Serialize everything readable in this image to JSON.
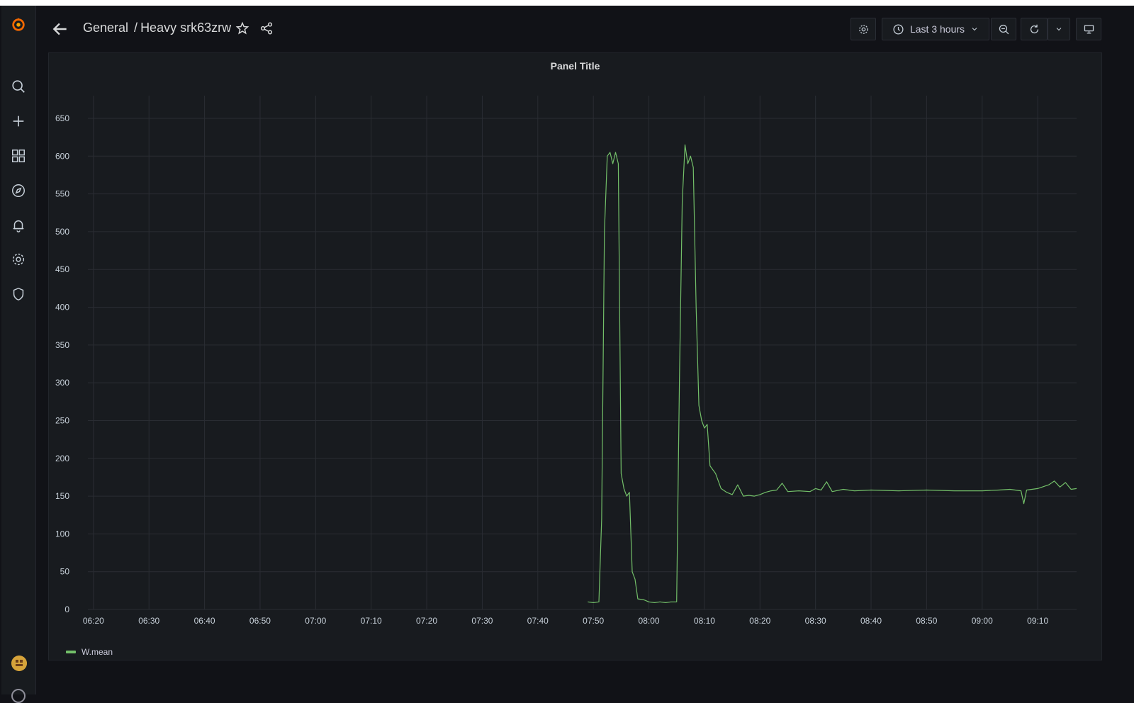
{
  "app": {
    "logo": "grafana-logo"
  },
  "sidebar": {
    "items": [
      {
        "icon": "search-icon"
      },
      {
        "icon": "plus-icon"
      },
      {
        "icon": "dashboards-icon"
      },
      {
        "icon": "explore-compass-icon"
      },
      {
        "icon": "alerting-bell-icon"
      },
      {
        "icon": "configuration-gear-icon"
      },
      {
        "icon": "server-admin-shield-icon"
      }
    ]
  },
  "header": {
    "breadcrumb": {
      "folder": "General",
      "separator": "/",
      "dashboard": "Heavy srk63zrw"
    },
    "time_picker": {
      "label": "Last 3 hours"
    }
  },
  "panel": {
    "title": "Panel Title",
    "legend": [
      {
        "name": "W.mean",
        "color": "#73bf69"
      }
    ]
  },
  "chart_data": {
    "type": "line",
    "title": "Panel Title",
    "xlabel": "",
    "ylabel": "",
    "x_ticks": [
      "06:20",
      "06:30",
      "06:40",
      "06:50",
      "07:00",
      "07:10",
      "07:20",
      "07:30",
      "07:40",
      "07:50",
      "08:00",
      "08:10",
      "08:20",
      "08:30",
      "08:40",
      "08:50",
      "09:00",
      "09:10"
    ],
    "y_ticks": [
      0,
      50,
      100,
      150,
      200,
      250,
      300,
      350,
      400,
      450,
      500,
      550,
      600,
      650
    ],
    "xlim": [
      "06:19",
      "09:17"
    ],
    "ylim": [
      0,
      680
    ],
    "grid": true,
    "legend_position": "bottom-left",
    "series": [
      {
        "name": "W.mean",
        "color": "#73bf69",
        "points": [
          [
            "07:49",
            10
          ],
          [
            "07:50",
            9
          ],
          [
            "07:51",
            10
          ],
          [
            "07:51.5",
            120
          ],
          [
            "07:52",
            500
          ],
          [
            "07:52.5",
            600
          ],
          [
            "07:53",
            605
          ],
          [
            "07:53.5",
            590
          ],
          [
            "07:54",
            605
          ],
          [
            "07:54.5",
            590
          ],
          [
            "07:55",
            180
          ],
          [
            "07:55.5",
            160
          ],
          [
            "07:56",
            150
          ],
          [
            "07:56.5",
            155
          ],
          [
            "07:57",
            50
          ],
          [
            "07:57.5",
            40
          ],
          [
            "07:58",
            14
          ],
          [
            "07:59",
            13
          ],
          [
            "08:00",
            10
          ],
          [
            "08:01",
            9
          ],
          [
            "08:02",
            10
          ],
          [
            "08:03",
            9
          ],
          [
            "08:04",
            10
          ],
          [
            "08:05",
            10
          ],
          [
            "08:05.5",
            300
          ],
          [
            "08:06",
            540
          ],
          [
            "08:06.5",
            615
          ],
          [
            "08:07",
            590
          ],
          [
            "08:07.5",
            600
          ],
          [
            "08:08",
            585
          ],
          [
            "08:08.5",
            400
          ],
          [
            "08:09",
            270
          ],
          [
            "08:09.5",
            250
          ],
          [
            "08:10",
            240
          ],
          [
            "08:10.5",
            245
          ],
          [
            "08:11",
            190
          ],
          [
            "08:12",
            180
          ],
          [
            "08:13",
            160
          ],
          [
            "08:14",
            155
          ],
          [
            "08:15",
            152
          ],
          [
            "08:16",
            165
          ],
          [
            "08:17",
            150
          ],
          [
            "08:18",
            151
          ],
          [
            "08:19",
            150
          ],
          [
            "08:20",
            152
          ],
          [
            "08:21",
            155
          ],
          [
            "08:22",
            157
          ],
          [
            "08:23",
            158
          ],
          [
            "08:24",
            167
          ],
          [
            "08:25",
            156
          ],
          [
            "08:27",
            157
          ],
          [
            "08:29",
            156
          ],
          [
            "08:30",
            160
          ],
          [
            "08:31",
            158
          ],
          [
            "08:32",
            169
          ],
          [
            "08:33",
            156
          ],
          [
            "08:35",
            159
          ],
          [
            "08:37",
            157
          ],
          [
            "08:40",
            158
          ],
          [
            "08:45",
            157
          ],
          [
            "08:50",
            158
          ],
          [
            "08:55",
            157
          ],
          [
            "09:00",
            157
          ],
          [
            "09:03",
            158
          ],
          [
            "09:05",
            159
          ],
          [
            "09:07",
            157
          ],
          [
            "09:07.5",
            140
          ],
          [
            "09:08",
            158
          ],
          [
            "09:10",
            160
          ],
          [
            "09:12",
            165
          ],
          [
            "09:13",
            170
          ],
          [
            "09:14",
            162
          ],
          [
            "09:15",
            168
          ],
          [
            "09:16",
            159
          ],
          [
            "09:17",
            160
          ]
        ]
      }
    ]
  }
}
